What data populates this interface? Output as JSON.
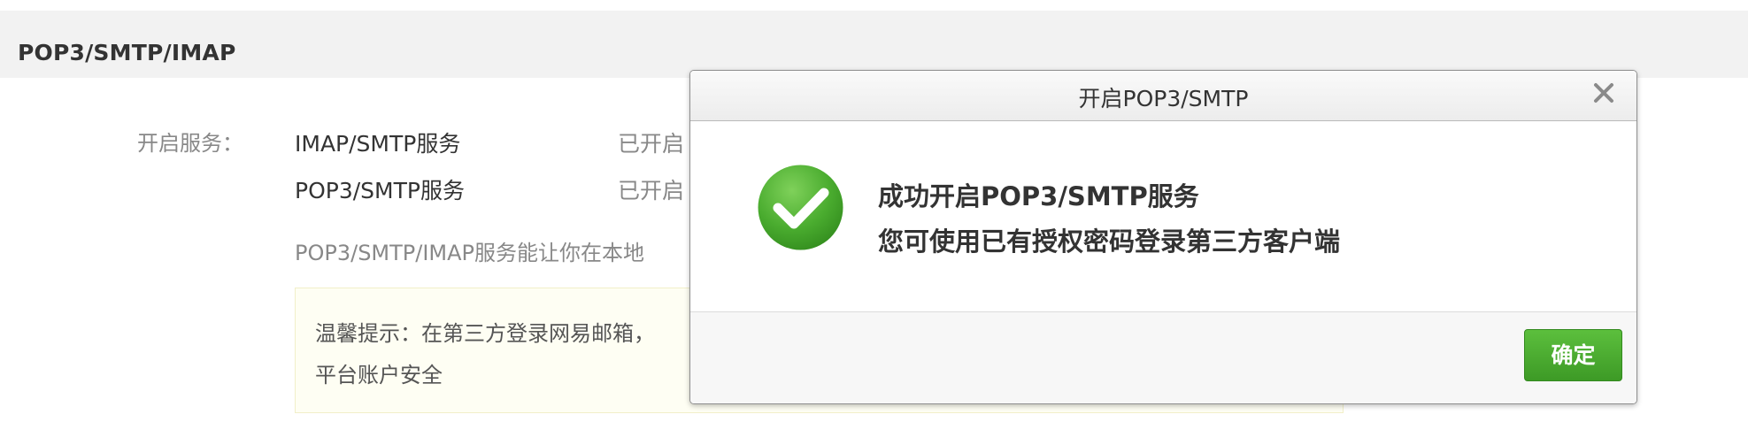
{
  "section": {
    "title": "POP3/SMTP/IMAP"
  },
  "services": {
    "label": "开启服务：",
    "items": [
      {
        "name": "IMAP/SMTP服务",
        "status": "已开启"
      },
      {
        "name": "POP3/SMTP服务",
        "status": "已开启"
      }
    ],
    "description": "POP3/SMTP/IMAP服务能让你在本地"
  },
  "tip": {
    "line1": "温馨提示：在第三方登录网易邮箱，",
    "line2": "平台账户安全"
  },
  "dialog": {
    "title": "开启POP3/SMTP",
    "message_line1": "成功开启POP3/SMTP服务",
    "message_line2": "您可使用已有授权密码登录第三方客户端",
    "confirm_label": "确定",
    "close_icon": "close-icon",
    "status_icon": "success-check-icon",
    "accent_color": "#4aac2f"
  }
}
